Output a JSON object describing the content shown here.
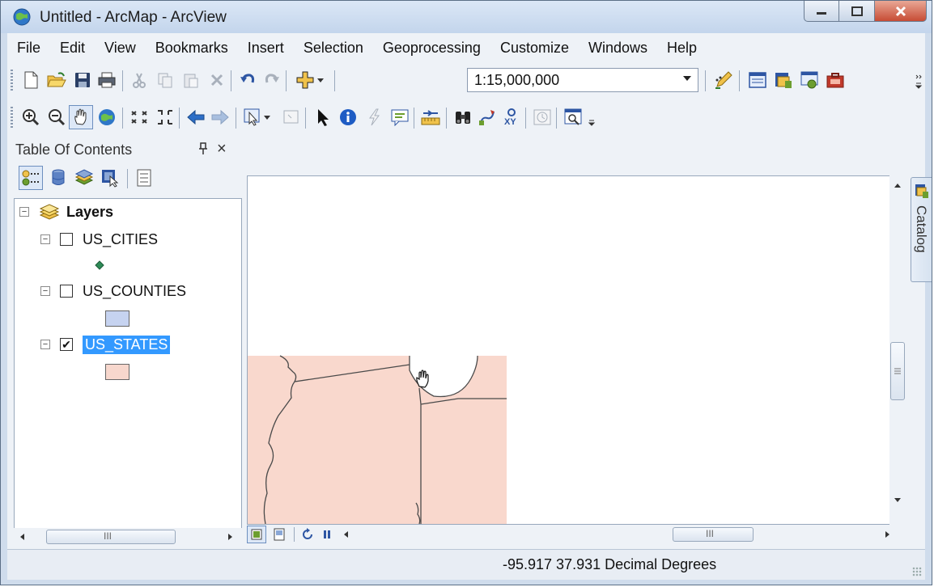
{
  "window": {
    "title": "Untitled - ArcMap - ArcView"
  },
  "menu": [
    "File",
    "Edit",
    "View",
    "Bookmarks",
    "Insert",
    "Selection",
    "Geoprocessing",
    "Customize",
    "Windows",
    "Help"
  ],
  "standard_toolbar": {
    "scale_value": "1:15,000,000"
  },
  "toc": {
    "title": "Table Of Contents",
    "pin_glyph": "·₱",
    "close_glyph": "×",
    "root_label": "Layers",
    "layers": [
      {
        "name": "US_CITIES",
        "checked": false,
        "symbol": "point",
        "symbol_color": "#2e8b57"
      },
      {
        "name": "US_COUNTIES",
        "checked": false,
        "symbol": "polygon",
        "symbol_color": "#c6d3f0"
      },
      {
        "name": "US_STATES",
        "checked": true,
        "selected": true,
        "symbol": "polygon",
        "symbol_color": "#f7d7cd"
      }
    ]
  },
  "map": {
    "state_fill": "#f9d8cd"
  },
  "side_tab": {
    "label": "Catalog"
  },
  "statusbar": {
    "coords": "-95.917  37.931 Decimal Degrees"
  },
  "icons": {
    "check": "✔",
    "minus": "−",
    "scrollbar_grip": "III"
  }
}
